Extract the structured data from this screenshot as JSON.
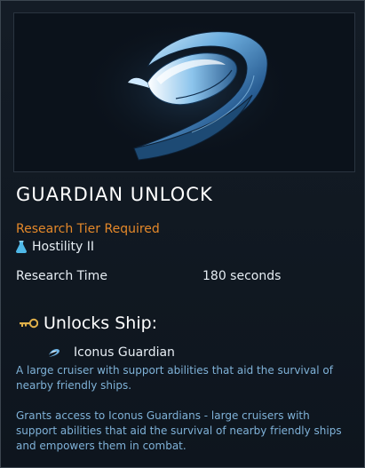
{
  "card": {
    "title": "GUARDIAN UNLOCK",
    "requirement": {
      "label": "Research Tier Required",
      "value": "Hostility II",
      "icon": "flask-icon",
      "label_color": "#e4882a"
    },
    "research_time": {
      "label": "Research Time",
      "value": "180 seconds"
    },
    "unlocks": {
      "heading": "Unlocks Ship:",
      "icon": "key-icon",
      "ship_name": "Iconus Guardian",
      "ship_icon": "ship-icon",
      "ship_description": "A large cruiser with support abilities that aid the survival of nearby friendly ships."
    },
    "description": "Grants access to Iconus Guardians - large cruisers with support abilities that aid the survival of nearby friendly ships and empowers them in combat.",
    "accent_text_color": "#7fb2d8"
  }
}
